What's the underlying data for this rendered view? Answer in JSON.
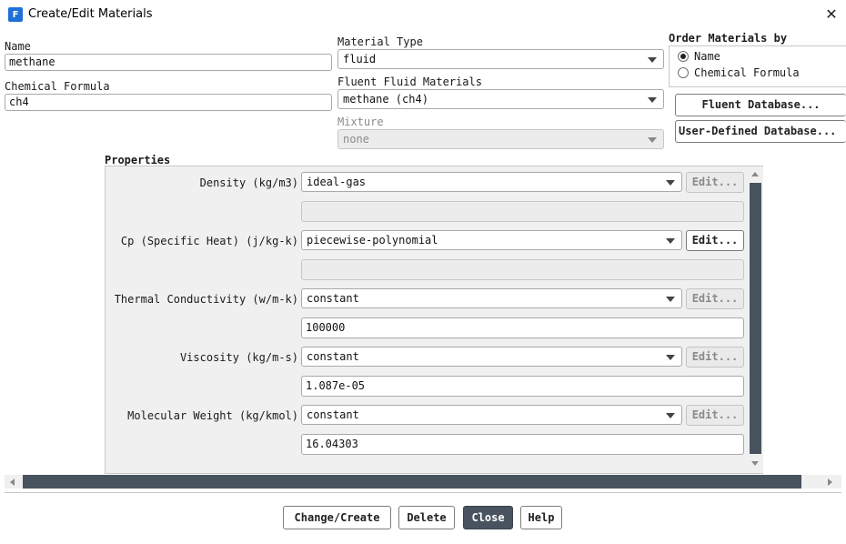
{
  "window": {
    "title": "Create/Edit Materials",
    "app_icon_letter": "F"
  },
  "name": {
    "label": "Name",
    "value": "methane"
  },
  "chemical_formula": {
    "label": "Chemical Formula",
    "value": "ch4"
  },
  "material_type": {
    "label": "Material Type",
    "value": "fluid"
  },
  "fluent_fluid_materials": {
    "label": "Fluent Fluid Materials",
    "value": "methane (ch4)"
  },
  "mixture": {
    "label": "Mixture",
    "value": "none"
  },
  "order_by": {
    "label": "Order Materials by",
    "options": [
      {
        "label": "Name",
        "selected": true
      },
      {
        "label": "Chemical Formula",
        "selected": false
      }
    ]
  },
  "database_buttons": {
    "fluent": "Fluent Database...",
    "user_defined": "User-Defined Database..."
  },
  "properties": {
    "label": "Properties",
    "rows": [
      {
        "label": "Density (kg/m3)",
        "method": "ideal-gas",
        "edit": "Edit...",
        "edit_enabled": false,
        "value": ""
      },
      {
        "label": "Cp (Specific Heat) (j/kg-k)",
        "method": "piecewise-polynomial",
        "edit": "Edit...",
        "edit_enabled": true,
        "value": ""
      },
      {
        "label": "Thermal Conductivity (w/m-k)",
        "method": "constant",
        "edit": "Edit...",
        "edit_enabled": false,
        "value": "100000"
      },
      {
        "label": "Viscosity (kg/m-s)",
        "method": "constant",
        "edit": "Edit...",
        "edit_enabled": false,
        "value": "1.087e-05"
      },
      {
        "label": "Molecular Weight (kg/kmol)",
        "method": "constant",
        "edit": "Edit...",
        "edit_enabled": false,
        "value": "16.04303"
      }
    ]
  },
  "footer": {
    "change_create": "Change/Create",
    "delete": "Delete",
    "close": "Close",
    "help": "Help"
  },
  "colors": {
    "accent_dark": "#49535f",
    "app_icon": "#1f6fd6"
  }
}
